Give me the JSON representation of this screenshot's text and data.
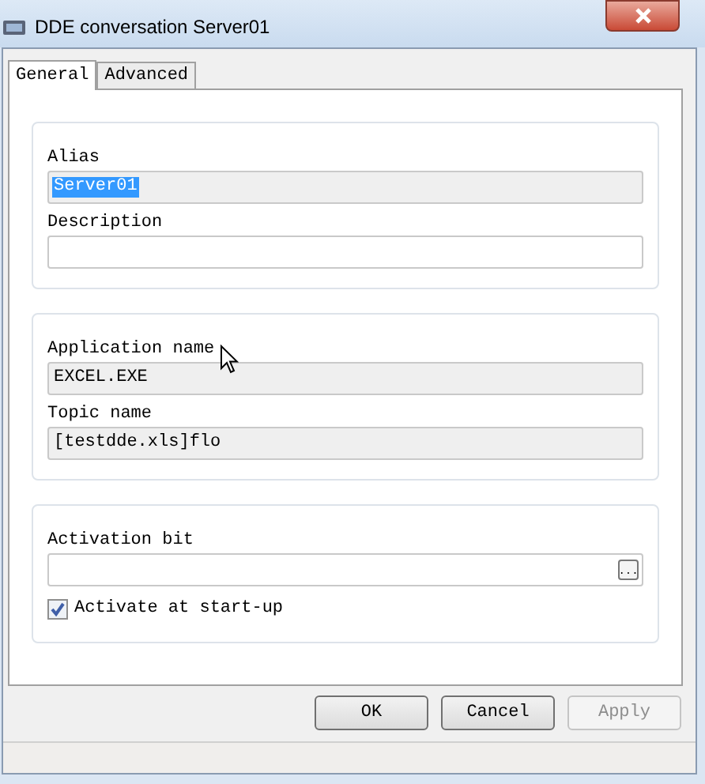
{
  "window": {
    "title": "DDE conversation Server01"
  },
  "tabs": [
    {
      "label": "General",
      "selected": true
    },
    {
      "label": "Advanced",
      "selected": false
    }
  ],
  "groups": [
    {
      "fields": [
        {
          "kind": "readonly",
          "label": "Alias",
          "value": "Server01",
          "text_selected": true
        },
        {
          "kind": "text",
          "label": "Description"
        }
      ]
    },
    {
      "fields": [
        {
          "kind": "readonly",
          "label": "Application name",
          "value": "EXCEL.EXE",
          "text_selected": false
        },
        {
          "kind": "readonly",
          "label": "Topic name",
          "value": "[testdde.xls]flo",
          "text_selected": false
        }
      ]
    },
    {
      "fields": [
        {
          "kind": "browse",
          "label": "Activation bit",
          "browse_label": "..."
        }
      ],
      "checkbox": {
        "label": "Activate at start-up",
        "checked": true
      }
    }
  ],
  "buttons": [
    {
      "label": "OK",
      "disabled": false
    },
    {
      "label": "Cancel",
      "disabled": false
    },
    {
      "label": "Apply",
      "disabled": true
    }
  ]
}
